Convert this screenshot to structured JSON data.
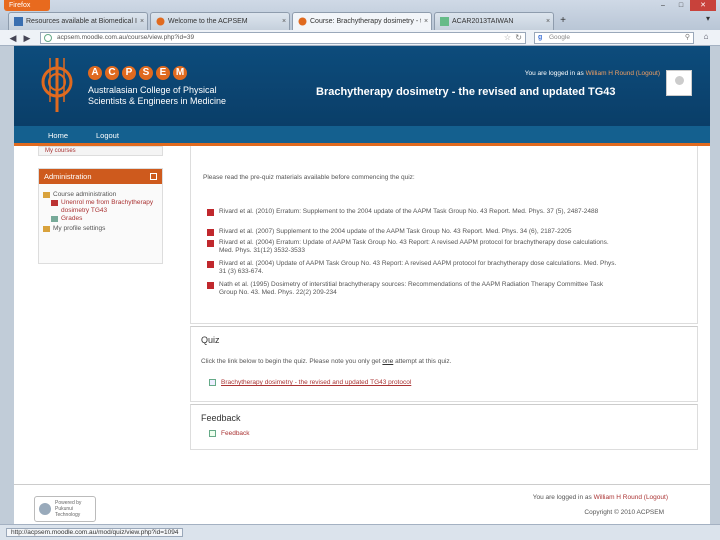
{
  "browser": {
    "menu_button": "Firefox",
    "window_controls": [
      "‒",
      "□",
      "✕"
    ],
    "tabs": [
      {
        "label": "Resources available at Biomedical Ima...",
        "active": false
      },
      {
        "label": "Welcome to the ACPSEM",
        "active": false
      },
      {
        "label": "Course: Brachytherapy dosimetry - the...",
        "active": true
      },
      {
        "label": "ACAR2013TAIWAN",
        "active": false
      }
    ],
    "new_tab": "+",
    "url": "acpsem.moodle.com.au/course/view.php?id=39",
    "search_placeholder": "Google"
  },
  "header": {
    "logo_letters": [
      "A",
      "C",
      "P",
      "S",
      "E",
      "M"
    ],
    "org_line1": "Australasian College of Physical",
    "org_line2": "Scientists & Engineers in Medicine",
    "login_prefix": "You are logged in as",
    "login_user": "William H Round",
    "login_logout": "(Logout)",
    "course_title": "Brachytherapy dosimetry - the revised and updated TG43"
  },
  "menu": {
    "home": "Home",
    "logout": "Logout"
  },
  "sidebar": {
    "prev_block": "My courses",
    "admin_title": "Administration",
    "course_admin": "Course administration",
    "unenrol": "Unenrol me from Brachytherapy dosimetry TG43",
    "grades": "Grades",
    "profile": "My profile settings"
  },
  "main": {
    "intro": "Please read the pre-quiz materials available before commencing the quiz:",
    "references": [
      "Rivard et al. (2010) Erratum: Supplement to the 2004 update of the AAPM Task Group No. 43 Report. Med. Phys. 37 (5), 2487-2488",
      "Rivard et al. (2007) Supplement to the 2004 update of the AAPM Task Group No. 43 Report. Med. Phys. 34 (6), 2187-2205",
      "Rivard et al. (2004) Erratum: Update of AAPM Task Group No. 43 Report: A revised AAPM protocol for brachytherapy dose calculations. Med. Phys. 31(12) 3532-3533",
      "Rivard et al. (2004) Update of AAPM Task Group No. 43 Report: A revised AAPM protocol for brachytherapy dose calculations. Med. Phys. 31 (3) 633-674.",
      "Nath et al. (1995) Dosimetry of interstitial brachytherapy sources: Recommendations of the AAPM Radiation Therapy Committee Task Group No. 43. Med. Phys. 22(2) 209-234"
    ],
    "quiz_title": "Quiz",
    "quiz_text_pre": "Click the link below to begin the quiz. Please note you only get",
    "quiz_text_one": "one",
    "quiz_text_post": "attempt at this quiz.",
    "quiz_link": "Brachytherapy dosimetry - the revised and updated TG43 protocol",
    "feedback_title": "Feedback",
    "feedback_link": "Feedback"
  },
  "footer": {
    "login_prefix": "You are logged in as",
    "login_user": "William H Round",
    "login_logout": "(Logout)",
    "copyright": "Copyright © 2010 ACPSEM",
    "powered_line1": "Powered by",
    "powered_line2": "Pukunui Technology"
  },
  "status": {
    "url": "http://acpsem.moodle.com.au/mod/quiz/view.php?id=1094"
  }
}
